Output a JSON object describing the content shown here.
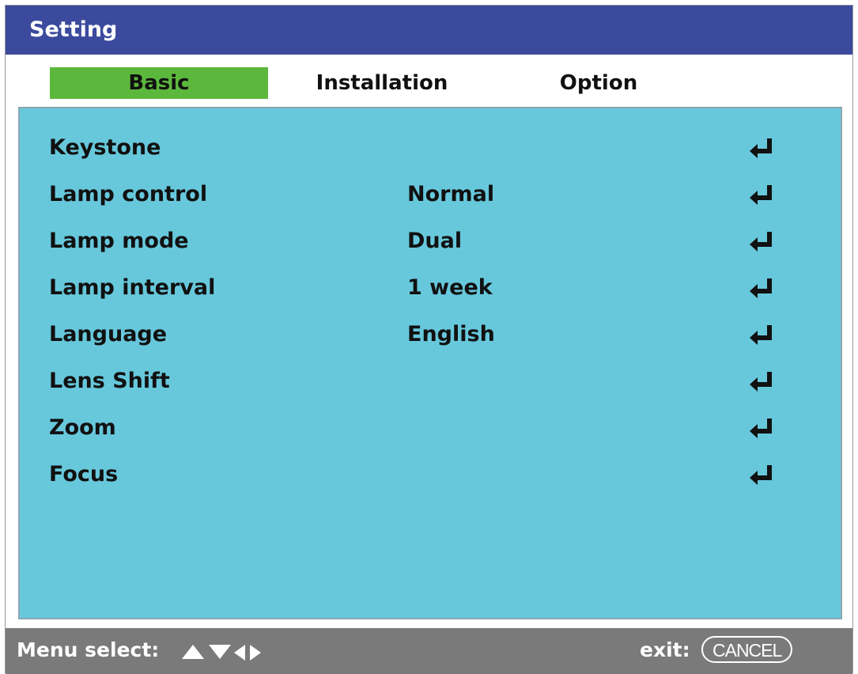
{
  "window": {
    "title": "Setting"
  },
  "tabs": [
    {
      "label": "Basic",
      "active": true
    },
    {
      "label": "Installation",
      "active": false
    },
    {
      "label": "Option",
      "active": false
    }
  ],
  "menu_items": [
    {
      "label": "Keystone",
      "value": ""
    },
    {
      "label": "Lamp control",
      "value": "Normal"
    },
    {
      "label": "Lamp mode",
      "value": "Dual"
    },
    {
      "label": "Lamp interval",
      "value": "1 week"
    },
    {
      "label": "Language",
      "value": "English"
    },
    {
      "label": "Lens Shift",
      "value": ""
    },
    {
      "label": "Zoom",
      "value": ""
    },
    {
      "label": "Focus",
      "value": ""
    }
  ],
  "footer": {
    "menu_select_label": "Menu select:",
    "exit_label": "exit:",
    "cancel_label": "CANCEL"
  },
  "colors": {
    "title_bar": "#3b4a9d",
    "active_tab": "#5cb83d",
    "panel": "#67c8dc",
    "footer": "#7a7a7a"
  },
  "icons": {
    "menu_item_action": "enter-return-icon",
    "navigation": [
      "arrow-up-icon",
      "arrow-down-icon",
      "arrow-left-icon",
      "arrow-right-icon"
    ]
  }
}
